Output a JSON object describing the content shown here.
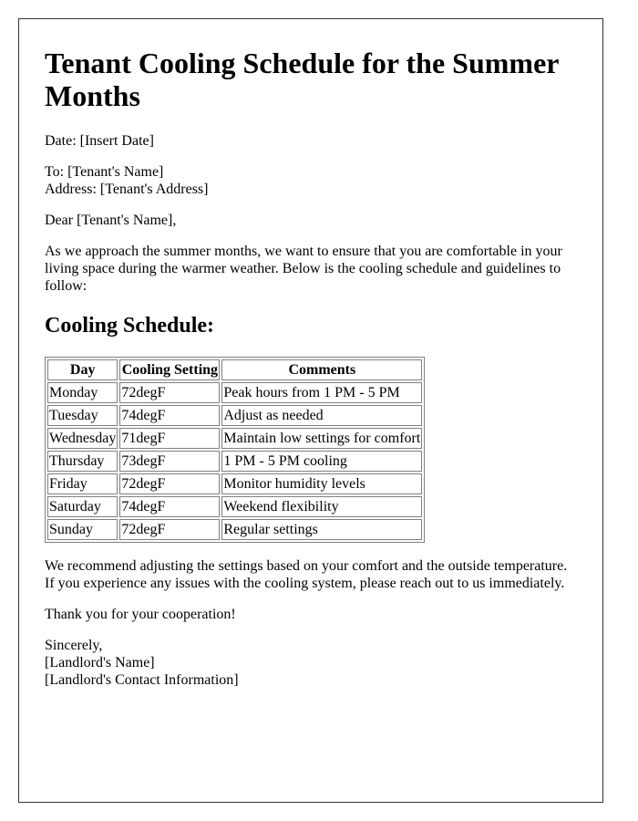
{
  "document": {
    "title": "Tenant Cooling Schedule for the Summer Months",
    "date_line": "Date: [Insert Date]",
    "to_line": "To: [Tenant's Name]",
    "address_line": "Address: [Tenant's Address]",
    "salutation": "Dear [Tenant's Name],",
    "intro": "As we approach the summer months, we want to ensure that you are comfortable in your living space during the warmer weather. Below is the cooling schedule and guidelines to follow:",
    "section_heading": "Cooling Schedule:",
    "table": {
      "headers": [
        "Day",
        "Cooling Setting",
        "Comments"
      ],
      "rows": [
        [
          "Monday",
          "72degF",
          "Peak hours from 1 PM - 5 PM"
        ],
        [
          "Tuesday",
          "74degF",
          "Adjust as needed"
        ],
        [
          "Wednesday",
          "71degF",
          "Maintain low settings for comfort"
        ],
        [
          "Thursday",
          "73degF",
          "1 PM - 5 PM cooling"
        ],
        [
          "Friday",
          "72degF",
          "Monitor humidity levels"
        ],
        [
          "Saturday",
          "74degF",
          "Weekend flexibility"
        ],
        [
          "Sunday",
          "72degF",
          "Regular settings"
        ]
      ]
    },
    "recommend_line1": "We recommend adjusting the settings based on your comfort and the outside temperature.",
    "recommend_line2": "If you experience any issues with the cooling system, please reach out to us immediately.",
    "thanks": "Thank you for your cooperation!",
    "closing": "Sincerely,",
    "signature_name": "[Landlord's Name]",
    "signature_contact": "[Landlord's Contact Information]"
  },
  "colors": {
    "page_border": "#333333",
    "table_border": "#808080",
    "text": "#000000",
    "background": "#ffffff"
  }
}
